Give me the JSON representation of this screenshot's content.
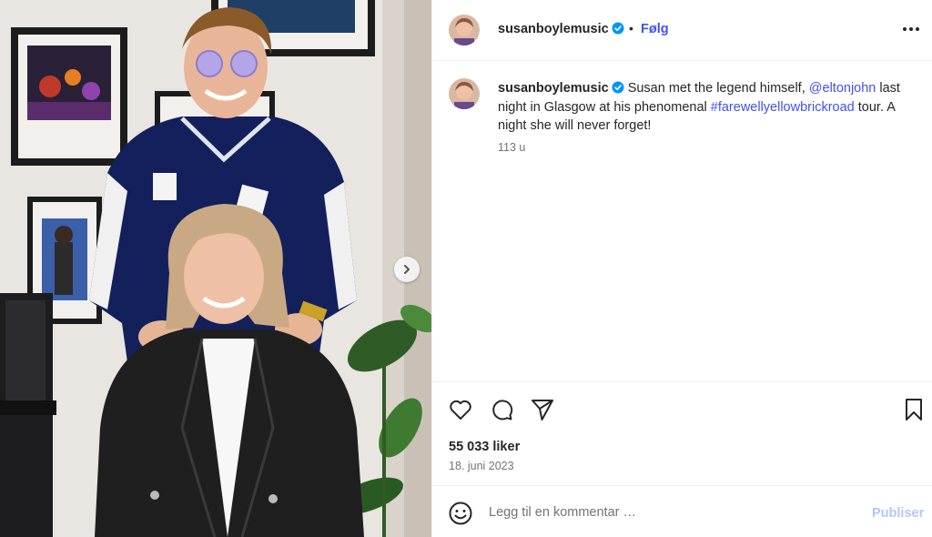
{
  "post": {
    "username": "susanboylemusic",
    "separator": "•",
    "follow_label": "Følg",
    "caption": {
      "text_before": "Susan met the legend himself, ",
      "mention": "@eltonjohn",
      "text_middle": " last night in Glasgow at his phenomenal ",
      "hashtag": "#farewellyellowbrickroad",
      "text_after": " tour. A night she will never forget!"
    },
    "time_ago": "113 u",
    "likes": "55 033 liker",
    "date": "18. juni 2023"
  },
  "comment_box": {
    "placeholder": "Legg til en kommentar …",
    "post_label": "Publiser"
  },
  "colors": {
    "link": "#4150f7",
    "verified": "#0095f6",
    "publish_disabled": "#b3c6fb",
    "muted": "#737373"
  },
  "icons": [
    "verified-badge-icon",
    "more-options-icon",
    "heart-icon",
    "comment-icon",
    "share-icon",
    "bookmark-icon",
    "emoji-icon",
    "chevron-right-icon"
  ]
}
